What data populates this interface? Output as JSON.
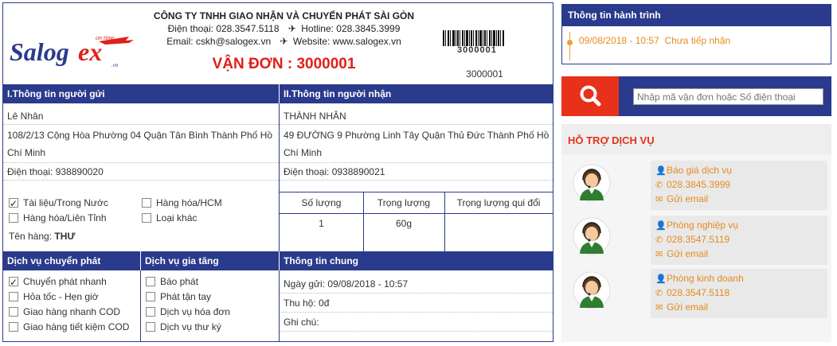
{
  "company": {
    "name": "CÔNG TY TNHH GIAO NHẬN VÀ CHUYỂN PHÁT SÀI GÒN",
    "phone": "Điện thoại: 028.3547.5118",
    "hotline": "Hotline: 028.3845.3999",
    "email": "Email: cskh@salogex.vn",
    "website": "Website: www.salogex.vn",
    "logo_text": "Salogex",
    "logo_tag": "on time"
  },
  "waybill": {
    "title": "VẬN ĐƠN : 3000001",
    "barcode_small": "3000001",
    "barcode_number": "3000001"
  },
  "sender": {
    "header": "I.Thông tin người gửi",
    "name": "Lê Nhân",
    "address": "108/2/13 Cộng Hòa Phường 04 Quận Tân Bình Thành Phố Hồ Chí Minh",
    "phone": "Điện thoại: 938890020"
  },
  "receiver": {
    "header": "II.Thông tin người nhận",
    "name": "THÀNH NHÂN",
    "address": "49 ĐƯỜNG 9 Phường Linh Tây Quận Thủ Đức Thành Phố Hồ Chí Minh",
    "phone": "Điện thoại: 0938890021"
  },
  "goods_type": {
    "options": [
      {
        "label": "Tài liệu/Trong Nước",
        "checked": true
      },
      {
        "label": "Hàng hóa/HCM",
        "checked": false
      },
      {
        "label": "Hàng hóa/Liên Tỉnh",
        "checked": false
      },
      {
        "label": "Loại khác",
        "checked": false
      }
    ],
    "name_label": "Tên hàng:",
    "name_value": "THƯ"
  },
  "package_table": {
    "headers": [
      "Số lượng",
      "Trọng lượng",
      "Trọng lượng qui đổi"
    ],
    "values": [
      "1",
      "60g",
      ""
    ]
  },
  "delivery_service": {
    "header": "Dịch vụ chuyển phát",
    "options": [
      {
        "label": "Chuyển phát nhanh",
        "checked": true
      },
      {
        "label": "Hỏa tốc - Hẹn giờ",
        "checked": false
      },
      {
        "label": "Giao hàng nhanh COD",
        "checked": false
      },
      {
        "label": "Giao hàng tiết kiệm COD",
        "checked": false
      }
    ]
  },
  "value_added_service": {
    "header": "Dịch vụ gia tăng",
    "options": [
      {
        "label": "Báo phát",
        "checked": false
      },
      {
        "label": "Phát tận tay",
        "checked": false
      },
      {
        "label": "Dịch vụ hóa đơn",
        "checked": false
      },
      {
        "label": "Dịch vụ thư ký",
        "checked": false
      }
    ]
  },
  "general_info": {
    "header": "Thông tin chung",
    "send_date": "Ngày gửi: 09/08/2018 - 10:57",
    "cod": "Thu hộ: 0đ",
    "note": "Ghi chú:"
  },
  "journey": {
    "header": "Thông tin hành trình",
    "entries": [
      {
        "time": "09/08/2018 - 10:57",
        "status": "Chưa tiếp nhận"
      }
    ]
  },
  "search": {
    "placeholder": "Nhập mã vận đơn hoặc Số điện thoại"
  },
  "support": {
    "header": "HỖ TRỢ DỊCH VỤ",
    "contacts": [
      {
        "name": "Báo giá dịch vụ",
        "phone": "028.3845.3999",
        "email": "Gửi email"
      },
      {
        "name": "Phòng nghiệp vụ",
        "phone": "028.3547.5119",
        "email": "Gửi email"
      },
      {
        "name": "Phòng kinh doanh",
        "phone": "028.3547.5118",
        "email": "Gửi email"
      }
    ]
  },
  "colors": {
    "navy": "#2a3a8c",
    "red": "#e8311a",
    "orange": "#e68a1f"
  }
}
